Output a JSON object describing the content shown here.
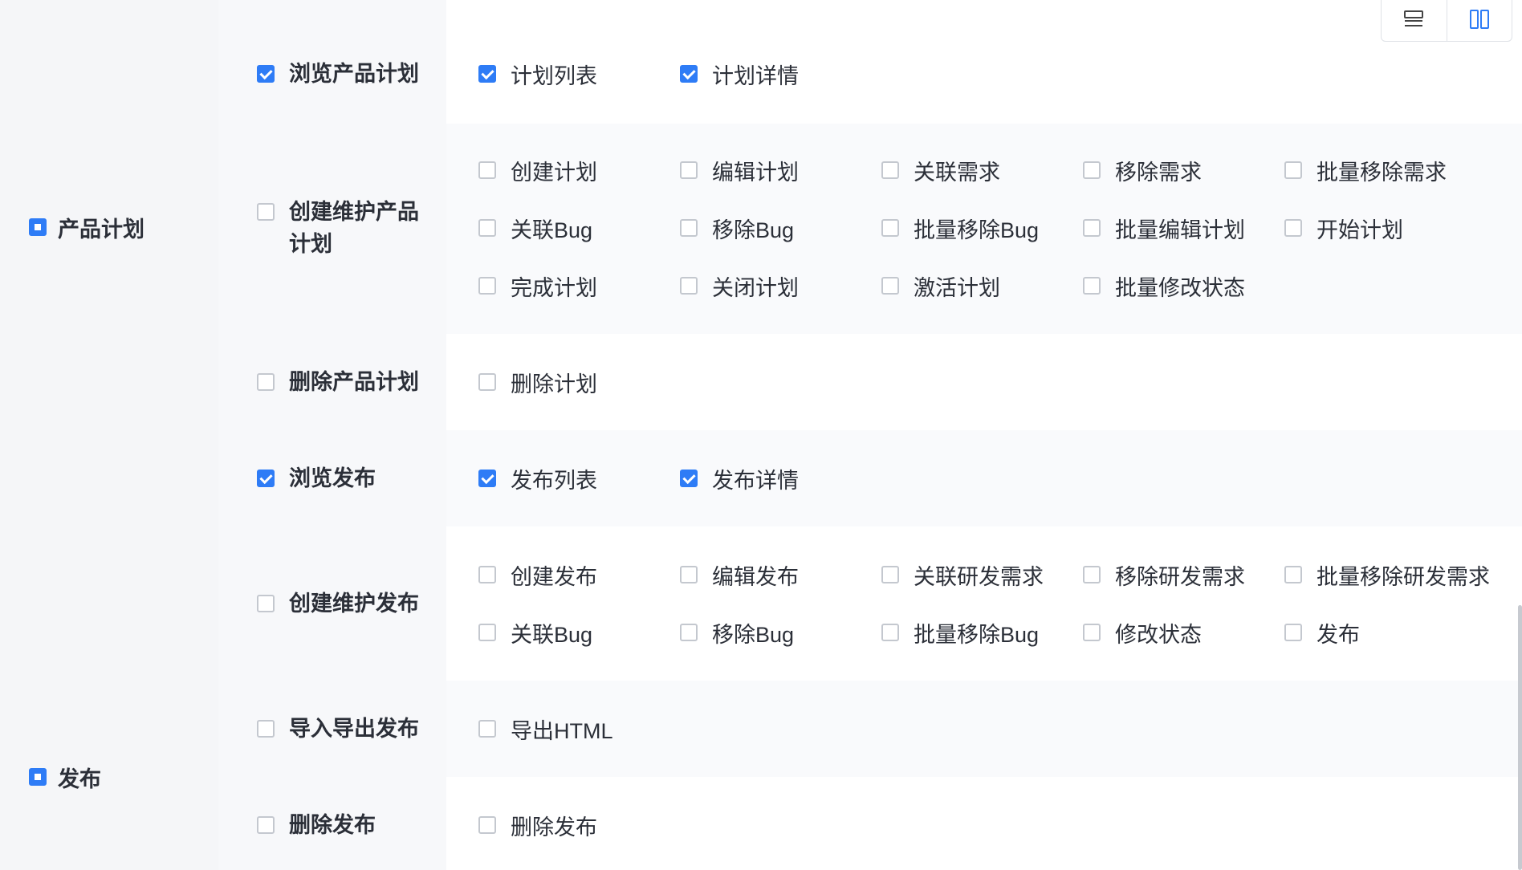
{
  "view_toggle": {
    "icons": [
      "list-layout-icon",
      "column-layout-icon"
    ],
    "active": "column-layout-icon"
  },
  "colors": {
    "accent": "#2e7cf6",
    "checkbox_border": "#c4c8cf",
    "text": "#2b2f38"
  },
  "groups": [
    {
      "label": "产品计划",
      "state": "indeterminate"
    },
    {
      "label": "发布",
      "state": "indeterminate"
    }
  ],
  "permissions": [
    {
      "label": "浏览产品计划",
      "checked": true,
      "actions": [
        {
          "label": "计划列表",
          "checked": true
        },
        {
          "label": "计划详情",
          "checked": true
        }
      ]
    },
    {
      "label": "创建维护产品计划",
      "checked": false,
      "actions": [
        {
          "label": "创建计划",
          "checked": false
        },
        {
          "label": "编辑计划",
          "checked": false
        },
        {
          "label": "关联需求",
          "checked": false
        },
        {
          "label": "移除需求",
          "checked": false
        },
        {
          "label": "批量移除需求",
          "checked": false
        },
        {
          "label": "关联Bug",
          "checked": false
        },
        {
          "label": "移除Bug",
          "checked": false
        },
        {
          "label": "批量移除Bug",
          "checked": false
        },
        {
          "label": "批量编辑计划",
          "checked": false
        },
        {
          "label": "开始计划",
          "checked": false
        },
        {
          "label": "完成计划",
          "checked": false
        },
        {
          "label": "关闭计划",
          "checked": false
        },
        {
          "label": "激活计划",
          "checked": false
        },
        {
          "label": "批量修改状态",
          "checked": false
        }
      ]
    },
    {
      "label": "删除产品计划",
      "checked": false,
      "actions": [
        {
          "label": "删除计划",
          "checked": false
        }
      ]
    },
    {
      "label": "浏览发布",
      "checked": true,
      "actions": [
        {
          "label": "发布列表",
          "checked": true
        },
        {
          "label": "发布详情",
          "checked": true
        }
      ]
    },
    {
      "label": "创建维护发布",
      "checked": false,
      "actions": [
        {
          "label": "创建发布",
          "checked": false
        },
        {
          "label": "编辑发布",
          "checked": false
        },
        {
          "label": "关联研发需求",
          "checked": false
        },
        {
          "label": "移除研发需求",
          "checked": false
        },
        {
          "label": "批量移除研发需求",
          "checked": false
        },
        {
          "label": "关联Bug",
          "checked": false
        },
        {
          "label": "移除Bug",
          "checked": false
        },
        {
          "label": "批量移除Bug",
          "checked": false
        },
        {
          "label": "修改状态",
          "checked": false
        },
        {
          "label": "发布",
          "checked": false
        }
      ]
    },
    {
      "label": "导入导出发布",
      "checked": false,
      "actions": [
        {
          "label": "导出HTML",
          "checked": false
        }
      ]
    },
    {
      "label": "删除发布",
      "checked": false,
      "actions": [
        {
          "label": "删除发布",
          "checked": false
        }
      ]
    }
  ]
}
